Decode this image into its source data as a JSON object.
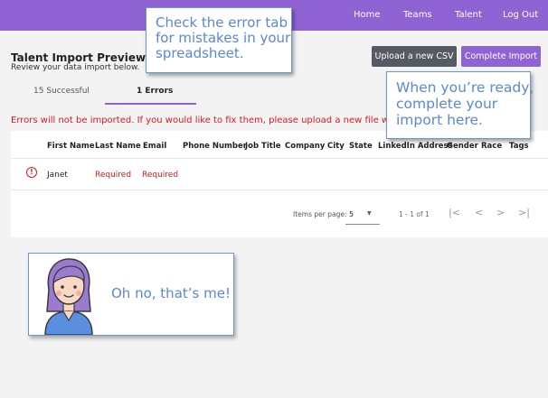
{
  "nav": {
    "home": "Home",
    "teams": "Teams",
    "talent": "Talent",
    "logout": "Log Out"
  },
  "header": {
    "title": "Talent Import Preview",
    "subtitle": "Review your data import below."
  },
  "actions": {
    "upload": "Upload a new CSV",
    "complete": "Complete Import"
  },
  "tabs": {
    "success": "15 Successful",
    "errors": "1 Errors"
  },
  "error_message": "Errors will not be imported. If you would like to fix them, please upload a new file with your",
  "table": {
    "columns": [
      "First Name",
      "Last Name",
      "Email",
      "Phone Number",
      "Job Title",
      "Company",
      "City",
      "State",
      "LinkedIn Address",
      "Gender",
      "Race",
      "Tags"
    ],
    "rows": [
      {
        "first_name": "Janet",
        "last_name": "Required",
        "email": "Required"
      }
    ]
  },
  "pagination": {
    "items_per_page_label": "Items per page:",
    "items_per_page_value": "5",
    "range": "1 - 1 of 1",
    "first": "|<",
    "prev": "<",
    "next": ">",
    "last": ">|"
  },
  "callouts": {
    "error_tab": [
      "Check the error tab",
      "for mistakes in your",
      "spreadsheet."
    ],
    "complete": [
      "When you’re ready,",
      "complete your",
      "import here."
    ]
  },
  "me_card": {
    "text": "Oh no, that’s me!"
  },
  "colors": {
    "accent": "#8f63d3",
    "error": "#d31b1b",
    "callout": "#5a87d6",
    "dark_button": "#555a63"
  }
}
